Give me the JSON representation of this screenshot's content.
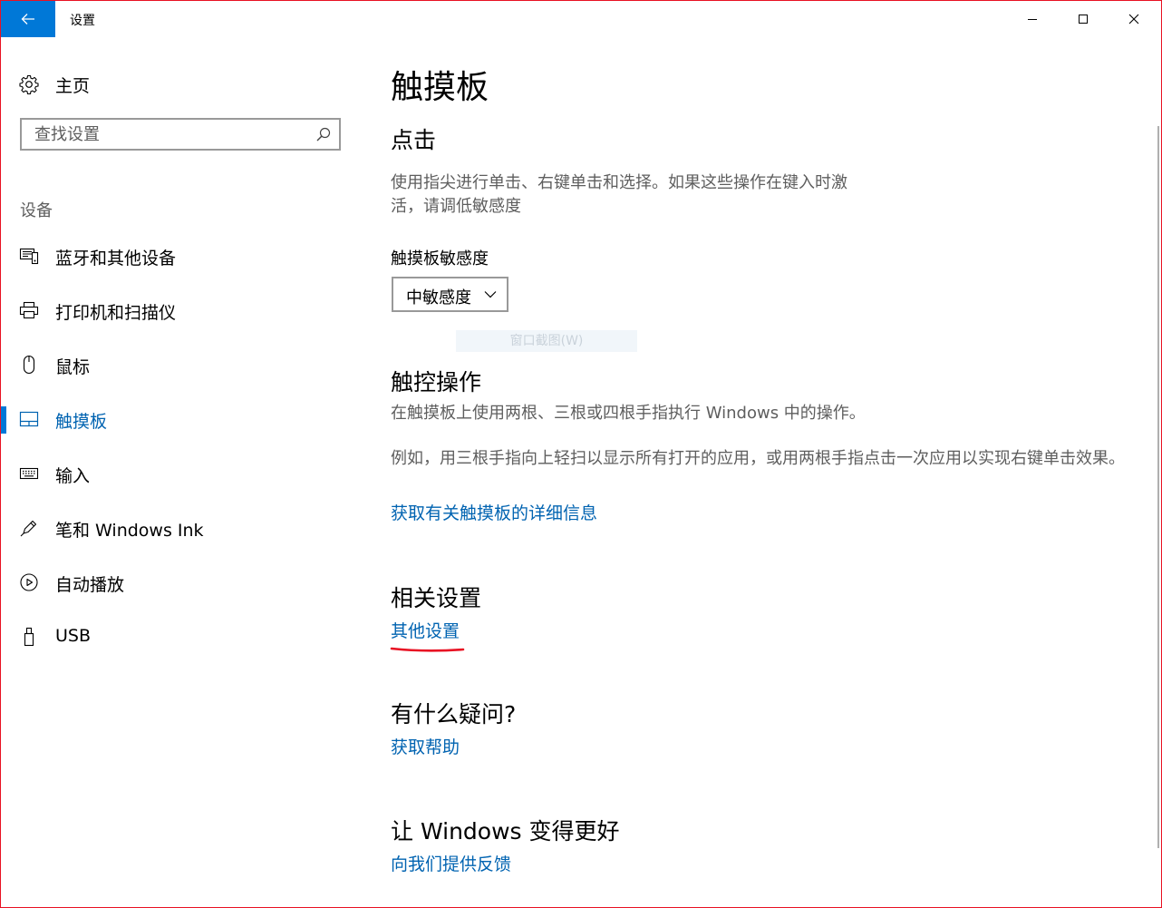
{
  "window": {
    "title": "设置",
    "back_icon": "back-arrow-icon",
    "minimize_icon": "minimize-icon",
    "maximize_icon": "maximize-icon",
    "close_icon": "close-icon"
  },
  "sidebar": {
    "home_label": "主页",
    "home_icon": "gear-icon",
    "search_placeholder": "查找设置",
    "search_icon": "search-icon",
    "group_label": "设备",
    "items": [
      {
        "label": "蓝牙和其他设备",
        "icon": "bluetooth-devices-icon"
      },
      {
        "label": "打印机和扫描仪",
        "icon": "printer-icon"
      },
      {
        "label": "鼠标",
        "icon": "mouse-icon"
      },
      {
        "label": "触摸板",
        "icon": "touchpad-icon",
        "active": true
      },
      {
        "label": "输入",
        "icon": "keyboard-icon"
      },
      {
        "label": "笔和 Windows Ink",
        "icon": "pen-icon"
      },
      {
        "label": "自动播放",
        "icon": "autoplay-icon"
      },
      {
        "label": "USB",
        "icon": "usb-icon"
      }
    ]
  },
  "main": {
    "title": "触摸板",
    "click": {
      "heading": "点击",
      "description": "使用指尖进行单击、右键单击和选择。如果这些操作在键入时激活，请调低敏感度",
      "sensitivity_label": "触摸板敏感度",
      "sensitivity_value": "中敏感度"
    },
    "overlay_text": "窗口截图(W)",
    "gestures": {
      "heading": "触控操作",
      "description1": "在触摸板上使用两根、三根或四根手指执行 Windows 中的操作。",
      "description2": "例如，用三根手指向上轻扫以显示所有打开的应用，或用两根手指点击一次应用以实现右键单击效果。",
      "link": "获取有关触摸板的详细信息"
    },
    "related": {
      "heading": "相关设置",
      "link": "其他设置"
    },
    "questions": {
      "heading": "有什么疑问?",
      "link": "获取帮助"
    },
    "feedback": {
      "heading": "让 Windows 变得更好",
      "link": "向我们提供反馈"
    }
  },
  "colors": {
    "accent": "#0078d7",
    "link": "#0063b1",
    "annotation": "#e81123",
    "secondary_text": "#5e5e5e"
  }
}
